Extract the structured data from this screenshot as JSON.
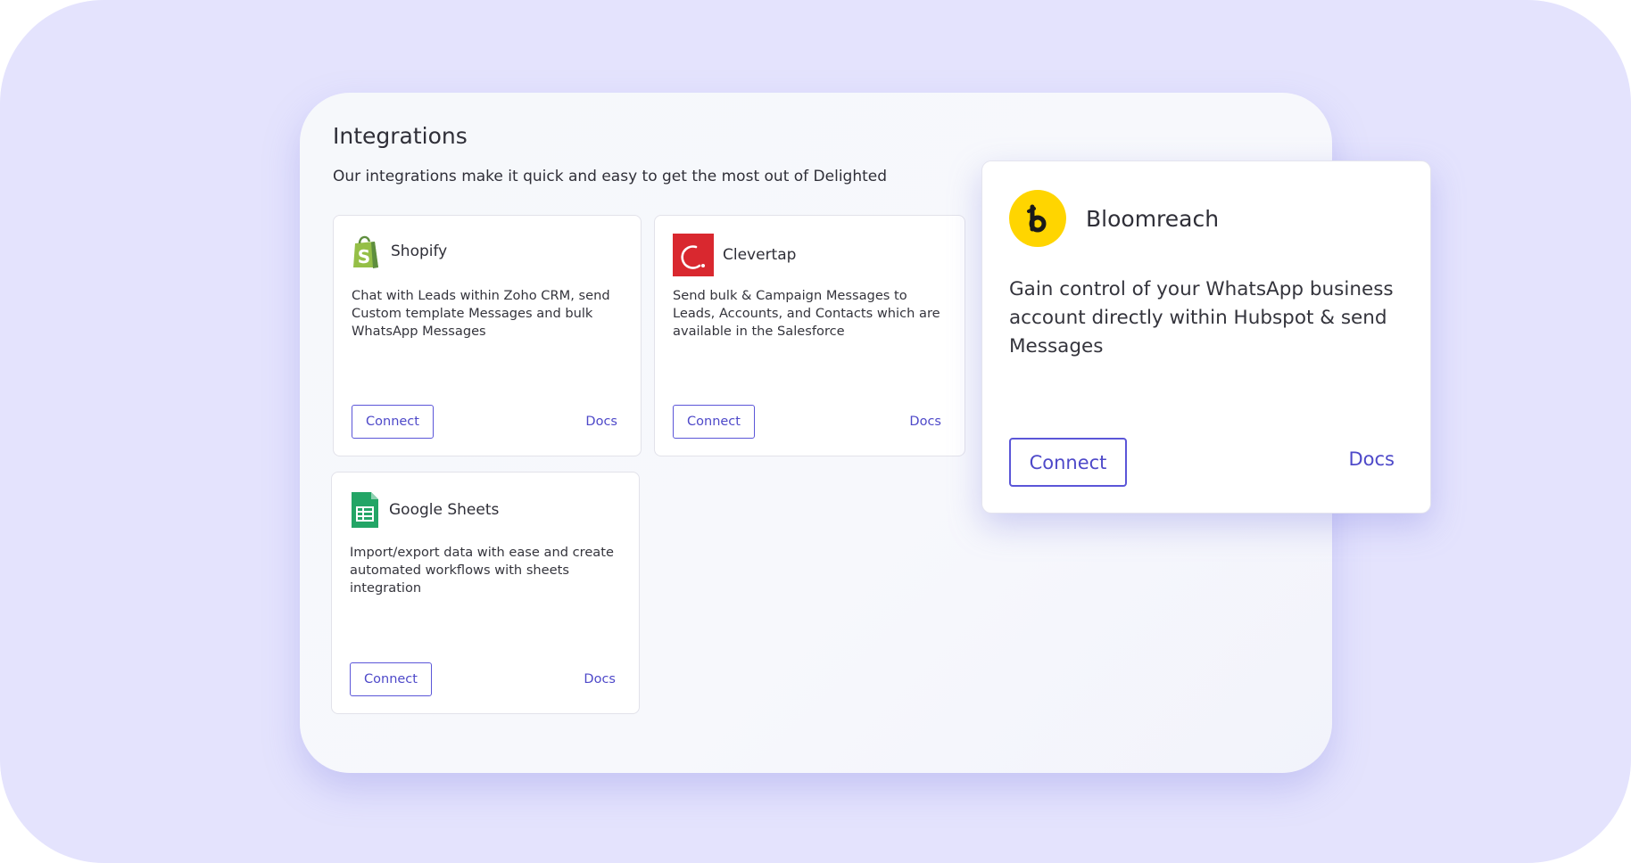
{
  "header": {
    "title": "Integrations",
    "subtitle": "Our integrations make it quick and easy to get the most out of Delighted"
  },
  "integrations": [
    {
      "name": "Shopify",
      "icon": "shopify-bag-icon",
      "description": "Chat with Leads within Zoho CRM, send Custom template Messages and bulk WhatsApp Messages",
      "connect_label": "Connect",
      "docs_label": "Docs"
    },
    {
      "name": "Clevertap",
      "icon": "clevertap-icon",
      "description": "Send bulk & Campaign Messages to Leads, Accounts, and Contacts which are available in the Salesforce",
      "connect_label": "Connect",
      "docs_label": "Docs"
    },
    {
      "name": "Google Sheets",
      "icon": "google-sheets-icon",
      "description": "Import/export data with ease and create automated workflows with sheets integration",
      "connect_label": "Connect",
      "docs_label": "Docs"
    }
  ],
  "featured": {
    "name": "Bloomreach",
    "icon": "bloomreach-icon",
    "description": "Gain control of your WhatsApp business account directly within Hubspot & send Messages",
    "connect_label": "Connect",
    "docs_label": "Docs"
  },
  "colors": {
    "background": "#e4e3fd",
    "accent": "#4e49c9",
    "shopify_green": "#95bf47",
    "clevertap_red": "#d9282f",
    "sheets_green": "#23a566",
    "bloomreach_yellow": "#ffd500"
  }
}
